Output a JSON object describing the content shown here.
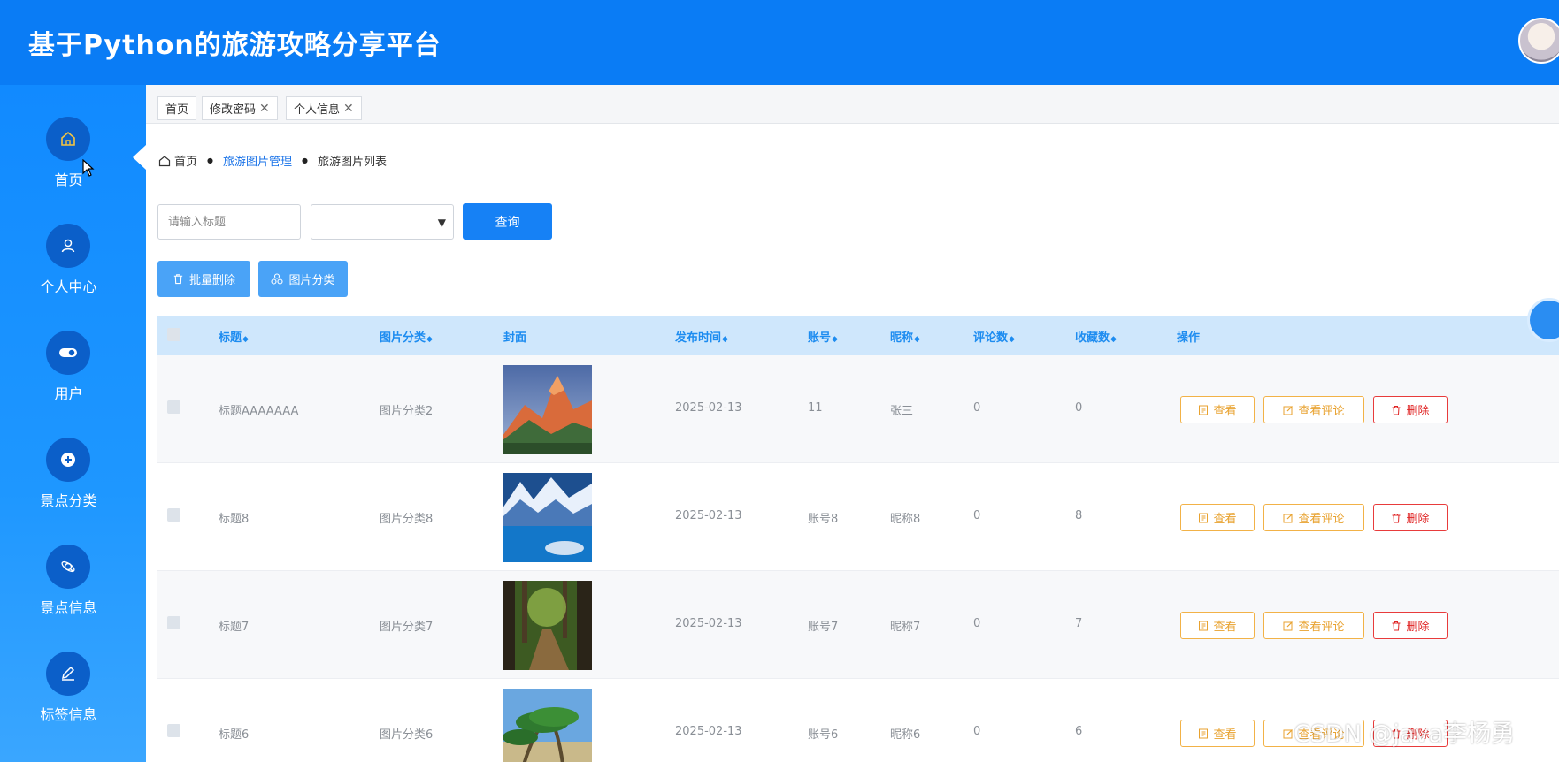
{
  "app": {
    "title": "基于Python的旅游攻略分享平台"
  },
  "sidebar": {
    "items": [
      {
        "label": "首页",
        "icon": "home-icon"
      },
      {
        "label": "个人中心",
        "icon": "user-icon"
      },
      {
        "label": "用户",
        "icon": "toggle-icon"
      },
      {
        "label": "景点分类",
        "icon": "plus-circle-icon"
      },
      {
        "label": "景点信息",
        "icon": "search-atom-icon"
      },
      {
        "label": "标签信息",
        "icon": "edit-icon"
      }
    ]
  },
  "tabs": [
    {
      "label": "首页",
      "closable": false
    },
    {
      "label": "修改密码",
      "closable": true
    },
    {
      "label": "个人信息",
      "closable": true
    }
  ],
  "breadcrumb": {
    "home": "首页",
    "section": "旅游图片管理",
    "current": "旅游图片列表"
  },
  "search": {
    "placeholder": "请输入标题",
    "query_label": "查询",
    "category_value": ""
  },
  "toolbar": {
    "batch_delete_label": "批量删除",
    "category_label": "图片分类"
  },
  "table": {
    "headers": {
      "title": "标题",
      "category": "图片分类",
      "cover": "封面",
      "publish_time": "发布时间",
      "account": "账号",
      "nickname": "昵称",
      "comments": "评论数",
      "favorites": "收藏数",
      "actions": "操作"
    },
    "rows": [
      {
        "title": "标题AAAAAAA",
        "category": "图片分类2",
        "cover": "mountain-sunset",
        "publish_time": "2025-02-13",
        "account": "11",
        "nickname": "张三",
        "comments": "0",
        "favorites": "0"
      },
      {
        "title": "标题8",
        "category": "图片分类8",
        "cover": "snowy-lake",
        "publish_time": "2025-02-13",
        "account": "账号8",
        "nickname": "昵称8",
        "comments": "0",
        "favorites": "8"
      },
      {
        "title": "标题7",
        "category": "图片分类7",
        "cover": "forest-path",
        "publish_time": "2025-02-13",
        "account": "账号7",
        "nickname": "昵称7",
        "comments": "0",
        "favorites": "7"
      },
      {
        "title": "标题6",
        "category": "图片分类6",
        "cover": "palm-beach",
        "publish_time": "2025-02-13",
        "account": "账号6",
        "nickname": "昵称6",
        "comments": "0",
        "favorites": "6"
      }
    ],
    "action_labels": {
      "view": "查看",
      "view_comments": "查看评论",
      "delete": "删除"
    }
  },
  "watermark": "CSDN @java李杨勇",
  "colors": {
    "primary": "#0a7cf5",
    "sidebar": "#1e97ff",
    "header_row": "#cfe7fc",
    "warning": "#e8a22f",
    "danger": "#e02424"
  }
}
